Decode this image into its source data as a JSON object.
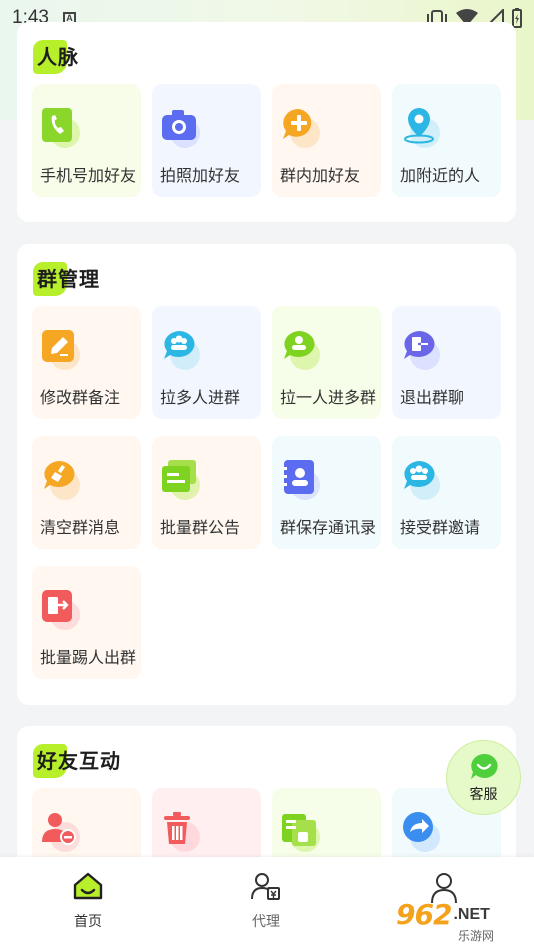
{
  "status_bar": {
    "time": "1:43",
    "notification_letter": "A"
  },
  "sections": [
    {
      "title": "人脉",
      "items": [
        {
          "label": "手机号加好友",
          "icon": "phone-book-icon"
        },
        {
          "label": "拍照加好友",
          "icon": "camera-icon"
        },
        {
          "label": "群内加好友",
          "icon": "chat-add-icon"
        },
        {
          "label": "加附近的人",
          "icon": "location-pin-icon"
        }
      ]
    },
    {
      "title": "群管理",
      "items": [
        {
          "label": "修改群备注",
          "icon": "edit-note-icon"
        },
        {
          "label": "拉多人进群",
          "icon": "multi-user-chat-icon"
        },
        {
          "label": "拉一人进多群",
          "icon": "single-user-chat-icon"
        },
        {
          "label": "退出群聊",
          "icon": "exit-chat-icon"
        },
        {
          "label": "清空群消息",
          "icon": "broom-chat-icon"
        },
        {
          "label": "批量群公告",
          "icon": "announcement-icon"
        },
        {
          "label": "群保存通讯录",
          "icon": "contact-book-icon"
        },
        {
          "label": "接受群邀请",
          "icon": "group-invite-icon"
        },
        {
          "label": "批量踢人出群",
          "icon": "kick-out-icon"
        }
      ]
    },
    {
      "title": "好友互动",
      "items": [
        {
          "label": "",
          "icon": "remove-user-icon"
        },
        {
          "label": "",
          "icon": "trash-icon"
        },
        {
          "label": "",
          "icon": "cards-icon"
        },
        {
          "label": "",
          "icon": "forward-icon"
        }
      ]
    }
  ],
  "float_button": {
    "label": "客服",
    "icon": "customer-service-icon"
  },
  "bottom_nav": [
    {
      "label": "首页",
      "icon": "home-icon",
      "active": true
    },
    {
      "label": "代理",
      "icon": "agent-icon",
      "active": false
    },
    {
      "label": "",
      "icon": "profile-icon",
      "active": false
    }
  ],
  "watermark": {
    "number": "962",
    "suffix": ".NET",
    "subtitle": "乐游网"
  },
  "colors": {
    "accent_green": "#b7ef2a",
    "icon_green": "#7ed321",
    "icon_blue": "#5b6cf0",
    "icon_orange": "#f5a623",
    "icon_cyan": "#2bb6e3",
    "icon_purple": "#6b66e8",
    "icon_red": "#f15b5b"
  }
}
